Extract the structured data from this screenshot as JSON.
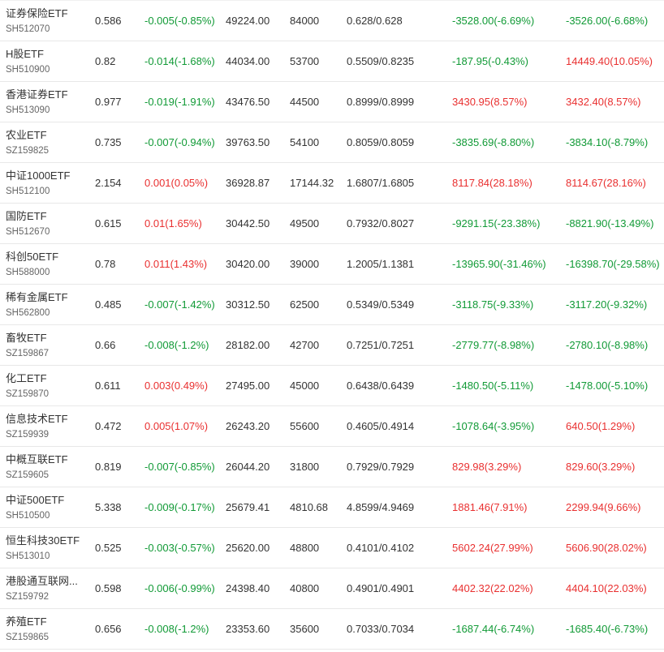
{
  "colors": {
    "up": "#e93030",
    "down": "#119a36",
    "text": "#333333",
    "code": "#666666"
  },
  "rows": [
    {
      "name": "证券保险ETF",
      "code": "SH512070",
      "price": "0.586",
      "change": "-0.005(-0.85%)",
      "change_dir": "down",
      "amount": "49224.00",
      "volume": "84000",
      "range": "0.628/0.628",
      "premium1": "-3528.00(-6.69%)",
      "premium1_dir": "down",
      "premium2": "-3526.00(-6.68%)",
      "premium2_dir": "down"
    },
    {
      "name": "H股ETF",
      "code": "SH510900",
      "price": "0.82",
      "change": "-0.014(-1.68%)",
      "change_dir": "down",
      "amount": "44034.00",
      "volume": "53700",
      "range": "0.5509/0.8235",
      "premium1": "-187.95(-0.43%)",
      "premium1_dir": "down",
      "premium2": "14449.40(10.05%)",
      "premium2_dir": "up"
    },
    {
      "name": "香港证券ETF",
      "code": "SH513090",
      "price": "0.977",
      "change": "-0.019(-1.91%)",
      "change_dir": "down",
      "amount": "43476.50",
      "volume": "44500",
      "range": "0.8999/0.8999",
      "premium1": "3430.95(8.57%)",
      "premium1_dir": "up",
      "premium2": "3432.40(8.57%)",
      "premium2_dir": "up"
    },
    {
      "name": "农业ETF",
      "code": "SZ159825",
      "price": "0.735",
      "change": "-0.007(-0.94%)",
      "change_dir": "down",
      "amount": "39763.50",
      "volume": "54100",
      "range": "0.8059/0.8059",
      "premium1": "-3835.69(-8.80%)",
      "premium1_dir": "down",
      "premium2": "-3834.10(-8.79%)",
      "premium2_dir": "down"
    },
    {
      "name": "中证1000ETF",
      "code": "SH512100",
      "price": "2.154",
      "change": "0.001(0.05%)",
      "change_dir": "up",
      "amount": "36928.87",
      "volume": "17144.32",
      "range": "1.6807/1.6805",
      "premium1": "8117.84(28.18%)",
      "premium1_dir": "up",
      "premium2": "8114.67(28.16%)",
      "premium2_dir": "up"
    },
    {
      "name": "国防ETF",
      "code": "SH512670",
      "price": "0.615",
      "change": "0.01(1.65%)",
      "change_dir": "up",
      "amount": "30442.50",
      "volume": "49500",
      "range": "0.7932/0.8027",
      "premium1": "-9291.15(-23.38%)",
      "premium1_dir": "down",
      "premium2": "-8821.90(-13.49%)",
      "premium2_dir": "down"
    },
    {
      "name": "科创50ETF",
      "code": "SH588000",
      "price": "0.78",
      "change": "0.011(1.43%)",
      "change_dir": "up",
      "amount": "30420.00",
      "volume": "39000",
      "range": "1.2005/1.1381",
      "premium1": "-13965.90(-31.46%)",
      "premium1_dir": "down",
      "premium2": "-16398.70(-29.58%)",
      "premium2_dir": "down"
    },
    {
      "name": "稀有金属ETF",
      "code": "SH562800",
      "price": "0.485",
      "change": "-0.007(-1.42%)",
      "change_dir": "down",
      "amount": "30312.50",
      "volume": "62500",
      "range": "0.5349/0.5349",
      "premium1": "-3118.75(-9.33%)",
      "premium1_dir": "down",
      "premium2": "-3117.20(-9.32%)",
      "premium2_dir": "down"
    },
    {
      "name": "畜牧ETF",
      "code": "SZ159867",
      "price": "0.66",
      "change": "-0.008(-1.2%)",
      "change_dir": "down",
      "amount": "28182.00",
      "volume": "42700",
      "range": "0.7251/0.7251",
      "premium1": "-2779.77(-8.98%)",
      "premium1_dir": "down",
      "premium2": "-2780.10(-8.98%)",
      "premium2_dir": "down"
    },
    {
      "name": "化工ETF",
      "code": "SZ159870",
      "price": "0.611",
      "change": "0.003(0.49%)",
      "change_dir": "up",
      "amount": "27495.00",
      "volume": "45000",
      "range": "0.6438/0.6439",
      "premium1": "-1480.50(-5.11%)",
      "premium1_dir": "down",
      "premium2": "-1478.00(-5.10%)",
      "premium2_dir": "down"
    },
    {
      "name": "信息技术ETF",
      "code": "SZ159939",
      "price": "0.472",
      "change": "0.005(1.07%)",
      "change_dir": "up",
      "amount": "26243.20",
      "volume": "55600",
      "range": "0.4605/0.4914",
      "premium1": "-1078.64(-3.95%)",
      "premium1_dir": "down",
      "premium2": "640.50(1.29%)",
      "premium2_dir": "up"
    },
    {
      "name": "中概互联ETF",
      "code": "SZ159605",
      "price": "0.819",
      "change": "-0.007(-0.85%)",
      "change_dir": "down",
      "amount": "26044.20",
      "volume": "31800",
      "range": "0.7929/0.7929",
      "premium1": "829.98(3.29%)",
      "premium1_dir": "up",
      "premium2": "829.60(3.29%)",
      "premium2_dir": "up"
    },
    {
      "name": "中证500ETF",
      "code": "SH510500",
      "price": "5.338",
      "change": "-0.009(-0.17%)",
      "change_dir": "down",
      "amount": "25679.41",
      "volume": "4810.68",
      "range": "4.8599/4.9469",
      "premium1": "1881.46(7.91%)",
      "premium1_dir": "up",
      "premium2": "2299.94(9.66%)",
      "premium2_dir": "up"
    },
    {
      "name": "恒生科技30ETF",
      "code": "SH513010",
      "price": "0.525",
      "change": "-0.003(-0.57%)",
      "change_dir": "down",
      "amount": "25620.00",
      "volume": "48800",
      "range": "0.4101/0.4102",
      "premium1": "5602.24(27.99%)",
      "premium1_dir": "up",
      "premium2": "5606.90(28.02%)",
      "premium2_dir": "up"
    },
    {
      "name": "港股通互联网...",
      "code": "SZ159792",
      "price": "0.598",
      "change": "-0.006(-0.99%)",
      "change_dir": "down",
      "amount": "24398.40",
      "volume": "40800",
      "range": "0.4901/0.4901",
      "premium1": "4402.32(22.02%)",
      "premium1_dir": "up",
      "premium2": "4404.10(22.03%)",
      "premium2_dir": "up"
    },
    {
      "name": "养殖ETF",
      "code": "SZ159865",
      "price": "0.656",
      "change": "-0.008(-1.2%)",
      "change_dir": "down",
      "amount": "23353.60",
      "volume": "35600",
      "range": "0.7033/0.7034",
      "premium1": "-1687.44(-6.74%)",
      "premium1_dir": "down",
      "premium2": "-1685.40(-6.73%)",
      "premium2_dir": "down"
    }
  ]
}
